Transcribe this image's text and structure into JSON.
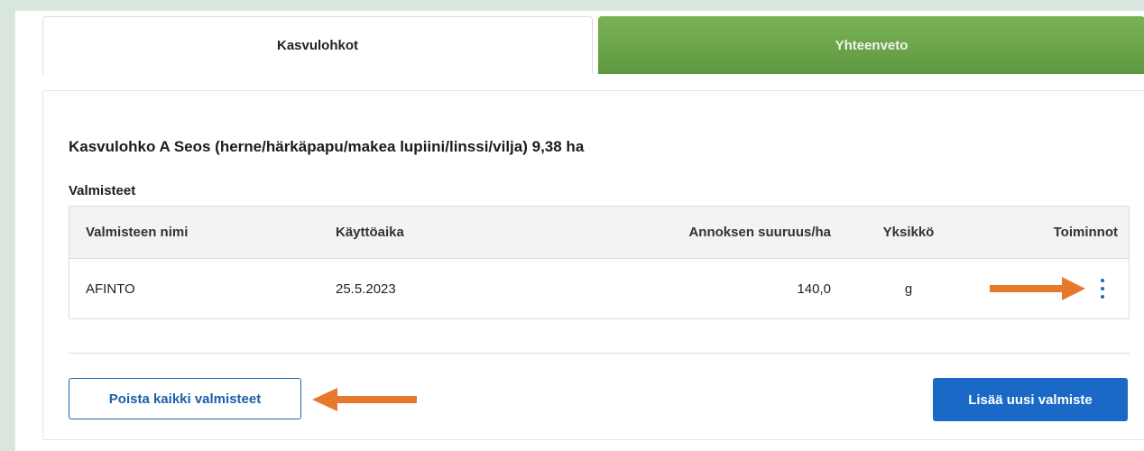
{
  "tabs": [
    {
      "label": "Kasvulohkot",
      "active": true
    },
    {
      "label": "Yhteenveto",
      "active": false
    }
  ],
  "card": {
    "title": "Kasvulohko A Seos (herne/härkäpapu/makea lupiini/linssi/vilja) 9,38 ha",
    "section_label": "Valmisteet"
  },
  "table": {
    "headers": {
      "name": "Valmisteen nimi",
      "time": "Käyttöaika",
      "dose": "Annoksen suuruus/ha",
      "unit": "Yksikkö",
      "actions": "Toiminnot"
    },
    "rows": [
      {
        "name": "AFINTO",
        "time": "25.5.2023",
        "dose": "140,0",
        "unit": "g",
        "actions_icon": "kebab-menu-icon"
      }
    ]
  },
  "buttons": {
    "remove_all": "Poista kaikki valmisteet",
    "add_new": "Lisää uusi valmiste"
  },
  "colors": {
    "accent_blue": "#1a69c6",
    "tab_green": "#6aa64a",
    "arrow_orange": "#e8792c",
    "background": "#d9e6de"
  }
}
